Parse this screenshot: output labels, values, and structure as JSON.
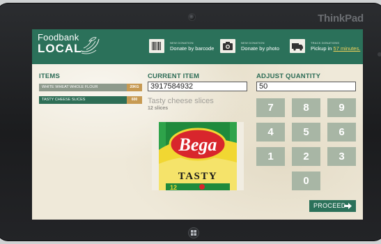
{
  "device": {
    "brand": "ThinkPad"
  },
  "header": {
    "logo_top": "Foodbank",
    "logo_bottom": "LOCAL",
    "buttons": [
      {
        "small": "NEW DONATION",
        "label": "Donate by barcode",
        "icon": "barcode-icon"
      },
      {
        "small": "NEW DONATION",
        "label": "Donate by photo",
        "icon": "camera-icon"
      },
      {
        "small": "TRACK DONATIONS",
        "label_prefix": "Pickup in ",
        "link": "57 minutes.",
        "icon": "truck-icon"
      }
    ]
  },
  "items": {
    "title": "ITEMS",
    "rows": [
      {
        "name": "WHITE WHEAT WHOLE FLOUR",
        "qty": "20KG"
      },
      {
        "name": "TASTY CHEESE SLICES",
        "qty": "600"
      }
    ]
  },
  "current_item": {
    "title": "CURRENT ITEM",
    "barcode": "3917584932",
    "product_name": "Tasty cheese slices",
    "product_sub": "12 slices",
    "package": {
      "brand": "Bega",
      "variety": "TASTY",
      "count": "12"
    }
  },
  "adjust": {
    "title": "ADJUST QUANTITY",
    "value": "50",
    "keys": [
      "7",
      "8",
      "9",
      "4",
      "5",
      "6",
      "1",
      "2",
      "3",
      "0"
    ]
  },
  "proceed_label": "PROCEED",
  "colors": {
    "header": "#2b715a",
    "accent_gold": "#c79a52",
    "keypad": "#a8b6a5",
    "title_green": "#2b6b55"
  }
}
